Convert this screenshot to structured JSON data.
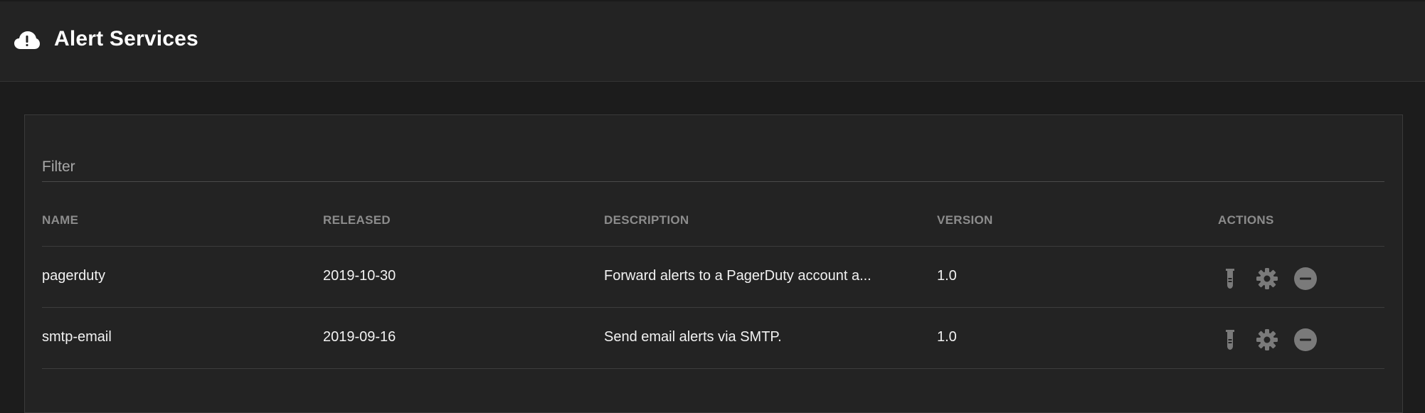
{
  "header": {
    "title": "Alert Services",
    "icon": "cloud-alert-icon"
  },
  "filter": {
    "placeholder": "Filter",
    "value": ""
  },
  "table": {
    "columns": [
      "NAME",
      "RELEASED",
      "DESCRIPTION",
      "VERSION",
      "ACTIONS"
    ],
    "rows": [
      {
        "name": "pagerduty",
        "released": "2019-10-30",
        "description": "Forward alerts to a PagerDuty account a...",
        "version": "1.0",
        "actions": [
          "test-tube-icon",
          "gear-icon",
          "remove-circle-icon"
        ]
      },
      {
        "name": "smtp-email",
        "released": "2019-09-16",
        "description": "Send email alerts via SMTP.",
        "version": "1.0",
        "actions": [
          "test-tube-icon",
          "gear-icon",
          "remove-circle-icon"
        ]
      }
    ]
  },
  "colors": {
    "background": "#1c1c1c",
    "panel": "#232323",
    "header_text": "#8c8c8c",
    "icon": "#7a7a7a"
  }
}
